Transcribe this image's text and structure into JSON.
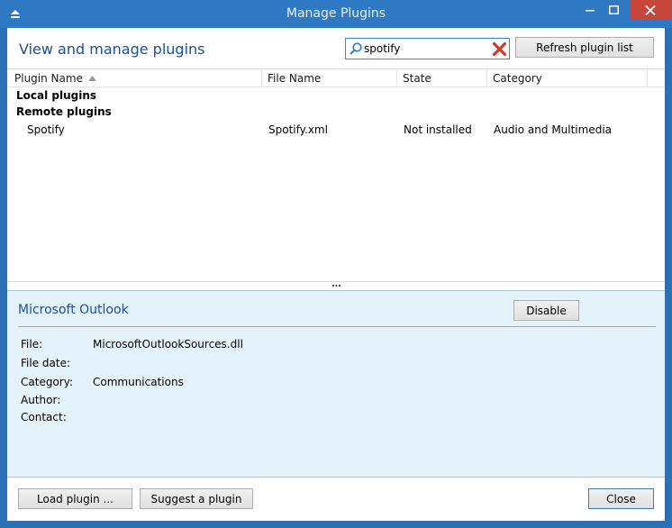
{
  "window": {
    "title": "Manage Plugins",
    "icon": "window-system-icon",
    "controls": [
      "minimize-icon",
      "maximize-icon",
      "close-icon"
    ]
  },
  "header": {
    "title": "View and manage plugins",
    "search": {
      "value": "spotify",
      "icon": "search-icon",
      "clear_icon": "clear-icon"
    },
    "refresh_label": "Refresh plugin list"
  },
  "list": {
    "columns": [
      "Plugin Name",
      "File Name",
      "State",
      "Category"
    ],
    "sort": {
      "column": "Plugin Name",
      "direction": "ascending"
    },
    "groups": [
      "Local plugins",
      "Remote plugins"
    ],
    "rows": [
      {
        "name": "Spotify",
        "file": "Spotify.xml",
        "state": "Not installed",
        "category": "Audio and Multimedia"
      }
    ]
  },
  "splitter": {
    "glyph": "..."
  },
  "details": {
    "title": "Microsoft Outlook",
    "disable_label": "Disable",
    "fields": [
      {
        "label": "File:",
        "value": "MicrosoftOutlookSources.dll"
      },
      {
        "label": "File date:",
        "value": ""
      },
      {
        "label": "Category:",
        "value": "Communications"
      },
      {
        "label": "Author:",
        "value": ""
      },
      {
        "label": "Contact:",
        "value": ""
      }
    ]
  },
  "footer": {
    "load_label": "Load plugin ...",
    "suggest_label": "Suggest a plugin",
    "close_label": "Close"
  },
  "colors": {
    "titlebar": "#2f78c4",
    "accent_text": "#1b4f9c",
    "details_bg": "#e4f2fa",
    "close_button": "#c7463b",
    "clear_icon": "#d03a2e"
  }
}
